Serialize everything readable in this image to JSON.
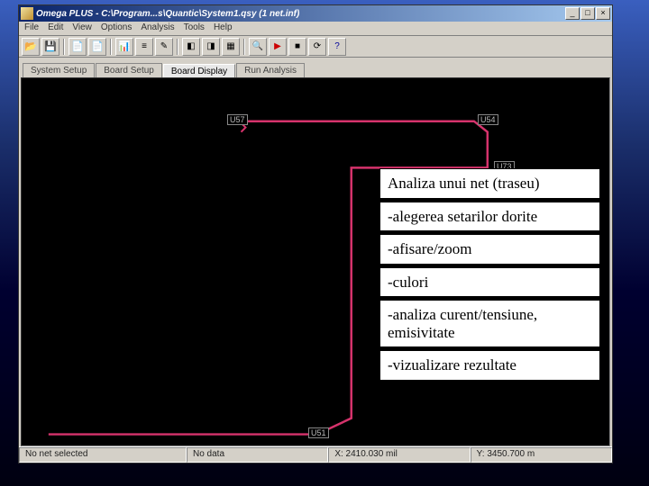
{
  "window": {
    "title": "Omega PLUS - C:\\Program...s\\Quantic\\System1.qsy (1 net.inf)"
  },
  "menubar": [
    "File",
    "Edit",
    "View",
    "Options",
    "Analysis",
    "Tools",
    "Help"
  ],
  "tabs": [
    {
      "label": "System Setup",
      "active": false
    },
    {
      "label": "Board Setup",
      "active": false
    },
    {
      "label": "Board Display",
      "active": true
    },
    {
      "label": "Run Analysis",
      "active": false
    }
  ],
  "nodes": {
    "u57": "U57",
    "u54": "U54",
    "u73": "U73",
    "u51": "U51"
  },
  "overlay": {
    "title": "Analiza unui net (traseu)",
    "items": [
      "-alegerea setarilor dorite",
      "-afisare/zoom",
      "-culori",
      "-analiza curent/tensiune, emisivitate",
      "-vizualizare rezultate"
    ]
  },
  "status": {
    "sel": "No net selected",
    "data": "No data",
    "x": "X: 2410.030 mil",
    "y": "Y: 3450.700 m"
  },
  "winbtns": {
    "min": "_",
    "max": "□",
    "close": "×"
  }
}
